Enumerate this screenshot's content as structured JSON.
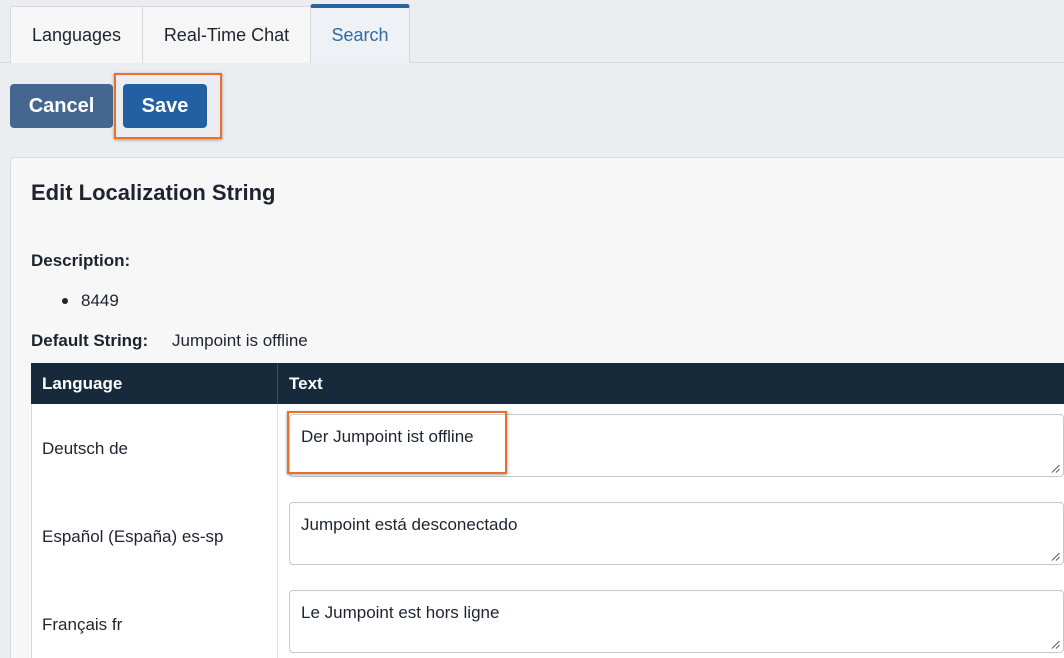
{
  "tabs": [
    {
      "label": "Languages",
      "active": false
    },
    {
      "label": "Real-Time Chat",
      "active": false
    },
    {
      "label": "Search",
      "active": true
    }
  ],
  "buttons": {
    "cancel_label": "Cancel",
    "save_label": "Save"
  },
  "panel": {
    "title": "Edit Localization String",
    "description_label": "Description:",
    "description_items": [
      "8449"
    ],
    "default_string_label": "Default String:",
    "default_string_value": "Jumpoint is offline"
  },
  "table": {
    "headers": {
      "language": "Language",
      "text": "Text"
    },
    "rows": [
      {
        "language": "Deutsch de",
        "text": "Der Jumpoint ist offline"
      },
      {
        "language": "Español (España) es-sp",
        "text": "Jumpoint está desconectado"
      },
      {
        "language": "Français fr",
        "text": "Le Jumpoint est hors ligne"
      }
    ]
  },
  "colors": {
    "accent": "#2360a3",
    "cancel": "#45678f",
    "table_header": "#172a3c",
    "highlight": "#e8702c"
  },
  "icons": {
    "resize_grip": "resize-grip-icon"
  }
}
